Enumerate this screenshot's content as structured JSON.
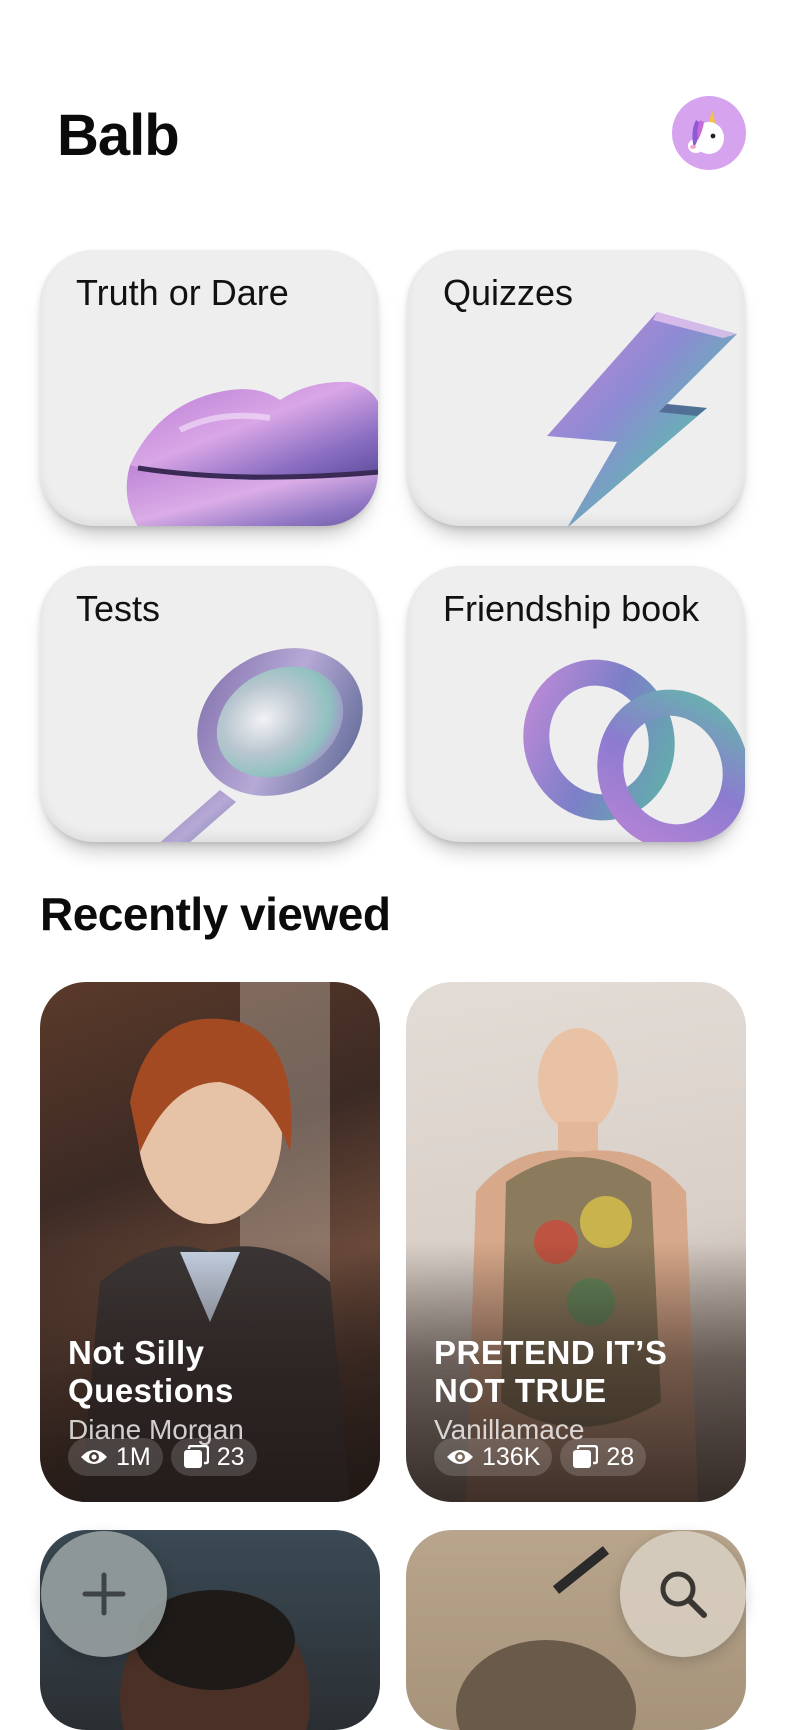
{
  "app": {
    "title": "Balb",
    "avatar_icon": "unicorn-icon",
    "avatar_bg": "#d6a4ee"
  },
  "categories": [
    {
      "label": "Truth or Dare",
      "icon": "lips-icon"
    },
    {
      "label": "Quizzes",
      "icon": "lightning-bolt-icon"
    },
    {
      "label": "Tests",
      "icon": "hand-mirror-icon"
    },
    {
      "label": "Friendship book",
      "icon": "linked-rings-icon"
    }
  ],
  "recently_viewed": {
    "title": "Recently viewed",
    "items": [
      {
        "title": "Not Silly Questions",
        "author": "Diane Morgan",
        "views": "1M",
        "cards": "23"
      },
      {
        "title": "PRETEND IT’S NOT TRUE",
        "author": "Vanillamace",
        "views": "136K",
        "cards": "28"
      }
    ]
  },
  "actions": {
    "add_icon": "plus-icon",
    "search_icon": "search-icon"
  },
  "colors": {
    "card_bg": "#eeeeee",
    "text": "#0b0b0b",
    "iridescent": [
      "#c98ad8",
      "#6aa6c8",
      "#6fc3b0"
    ]
  }
}
